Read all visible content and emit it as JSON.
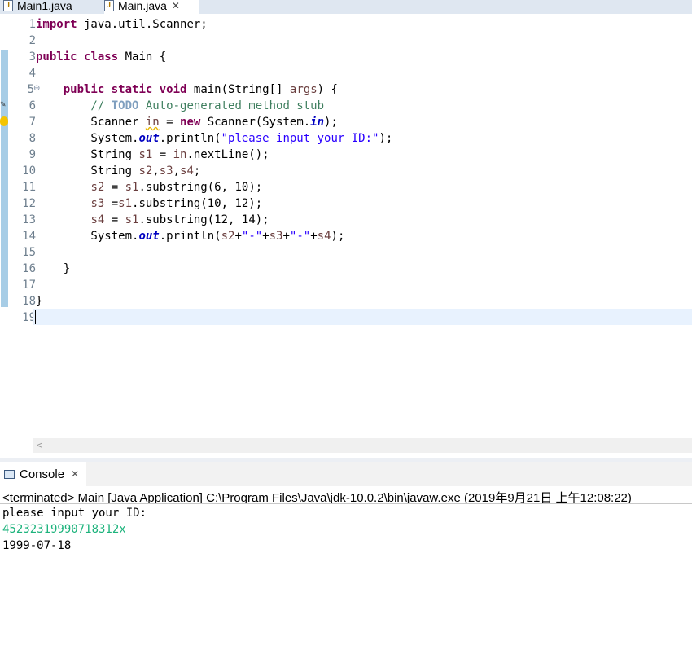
{
  "tabs": [
    {
      "label": "Main1.java",
      "active": false
    },
    {
      "label": "Main.java",
      "active": true,
      "close": "✕"
    }
  ],
  "editor": {
    "line_numbers": [
      "1",
      "2",
      "3",
      "4",
      "5",
      "6",
      "7",
      "8",
      "9",
      "10",
      "11",
      "12",
      "13",
      "14",
      "15",
      "16",
      "17",
      "18",
      "19"
    ],
    "fold_marker": "⊖",
    "code": {
      "l1_kw": "import",
      "l1_rest": " java.util.Scanner;",
      "l3_kw1": "public",
      "l3_kw2": "class",
      "l3_rest": " Main {",
      "l5_indent": "    ",
      "l5_kw1": "public",
      "l5_kw2": "static",
      "l5_kw3": "void",
      "l5_mid": " main(String[] ",
      "l5_param": "args",
      "l5_end": ") {",
      "l6_a": "        // ",
      "l6_todo": "TODO",
      "l6_b": " Auto-generated method stub",
      "l7_a": "        Scanner ",
      "l7_var": "in",
      "l7_b": " = ",
      "l7_kw": "new",
      "l7_c": " Scanner(System.",
      "l7_fi": "in",
      "l7_d": ");",
      "l8_a": "        System.",
      "l8_fi": "out",
      "l8_b": ".println(",
      "l8_str": "\"please input your ID:\"",
      "l8_c": ");",
      "l9_a": "        String ",
      "l9_var": "s1",
      "l9_b": " = ",
      "l9_var2": "in",
      "l9_c": ".nextLine();",
      "l10_a": "        String ",
      "l10_v1": "s2",
      "l10_c1": ",",
      "l10_v2": "s3",
      "l10_c2": ",",
      "l10_v3": "s4",
      "l10_end": ";",
      "l11_a": "        ",
      "l11_v": "s2",
      "l11_b": " = ",
      "l11_v2": "s1",
      "l11_c": ".substring(6, 10);",
      "l12_a": "        ",
      "l12_v": "s3",
      "l12_b": " =",
      "l12_v2": "s1",
      "l12_c": ".substring(10, 12);",
      "l13_a": "        ",
      "l13_v": "s4",
      "l13_b": " = ",
      "l13_v2": "s1",
      "l13_c": ".substring(12, 14);",
      "l14_a": "        System.",
      "l14_fi": "out",
      "l14_b": ".println(",
      "l14_v1": "s2",
      "l14_p1": "+",
      "l14_s1": "\"-\"",
      "l14_p2": "+",
      "l14_v2": "s3",
      "l14_p3": "+",
      "l14_s2": "\"-\"",
      "l14_p4": "+",
      "l14_v3": "s4",
      "l14_end": ");",
      "l16": "    }",
      "l18": "}"
    },
    "scroll_left_arrow": "<"
  },
  "console": {
    "title": "Console",
    "close": "✕",
    "status": "<terminated> Main [Java Application] C:\\Program Files\\Java\\jdk-10.0.2\\bin\\javaw.exe (2019年9月21日 上午12:08:22)",
    "output": [
      "please input your ID:",
      "45232319990718312x",
      "1999-07-18"
    ],
    "input_color": "#1db37c"
  },
  "colors": {
    "keyword": "#7f0055",
    "comment": "#3f7f5f",
    "string": "#2a00ff",
    "field": "#0000c0",
    "current_line": "#e8f2fe"
  }
}
